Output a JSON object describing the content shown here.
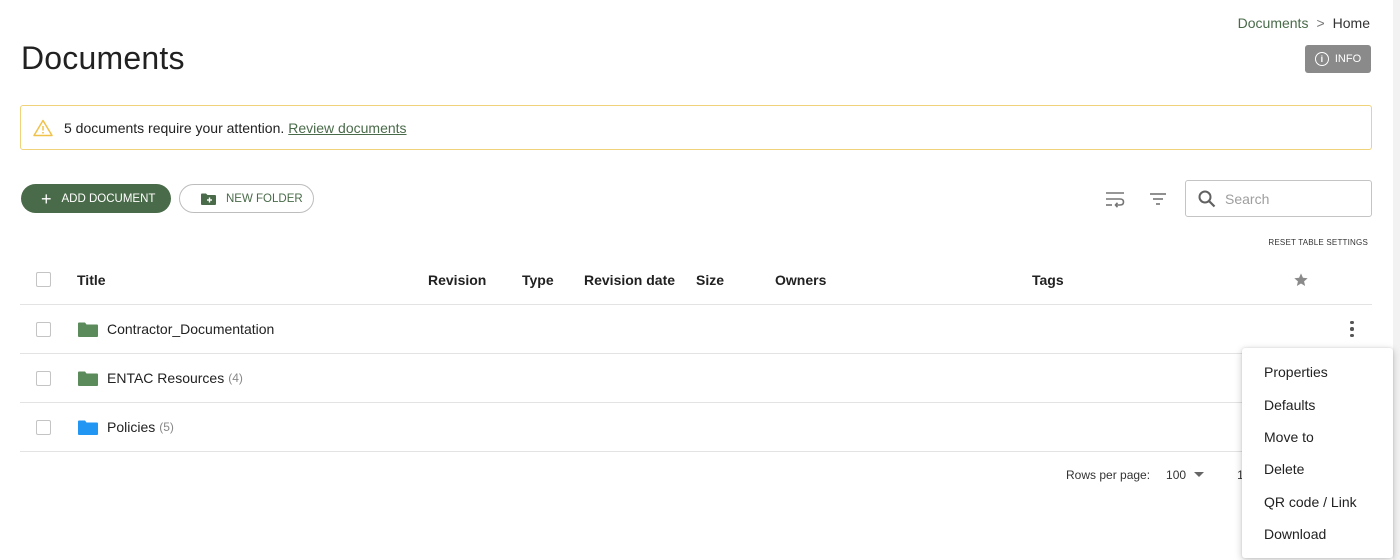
{
  "breadcrumb": {
    "parent": "Documents",
    "separator": ">",
    "current": "Home"
  },
  "page": {
    "title": "Documents"
  },
  "info_button": {
    "icon": "info-icon",
    "label": "INFO"
  },
  "alert": {
    "text": "5 documents require your attention.",
    "link": "Review documents",
    "icon": "warning-icon",
    "border_color": "#f0d27a"
  },
  "toolbar": {
    "add_label": "ADD DOCUMENT",
    "new_folder_label": "NEW FOLDER",
    "wrap_icon": "wrap-text-icon",
    "filter_icon": "filter-icon",
    "search_placeholder": "Search",
    "reset_label": "RESET TABLE SETTINGS"
  },
  "table": {
    "columns": {
      "title": "Title",
      "revision": "Revision",
      "type": "Type",
      "revision_date": "Revision date",
      "size": "Size",
      "owners": "Owners",
      "tags": "Tags",
      "favorite_icon": "star-icon"
    },
    "rows": [
      {
        "name": "Contractor_Documentation",
        "count": "",
        "folder_color": "#5b8a5b"
      },
      {
        "name": "ENTAC Resources",
        "count": "(4)",
        "folder_color": "#5b8a5b"
      },
      {
        "name": "Policies",
        "count": "(5)",
        "folder_color": "#2196f3"
      }
    ]
  },
  "pagination": {
    "rows_per_page_label": "Rows per page:",
    "rows_per_page": "100",
    "range": "1"
  },
  "context_menu": {
    "items": [
      "Properties",
      "Defaults",
      "Move to",
      "Delete",
      "QR code / Link",
      "Download"
    ]
  },
  "colors": {
    "primary": "#4a6b4a",
    "info_bg": "#8a8a8a"
  }
}
